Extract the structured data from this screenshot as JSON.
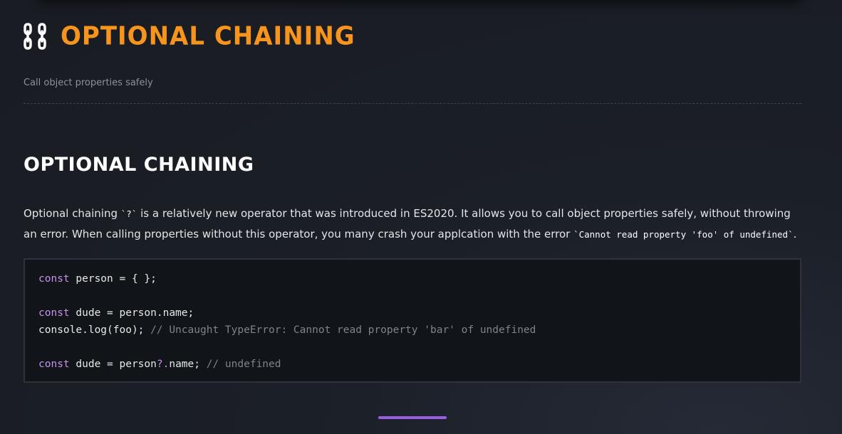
{
  "header": {
    "icon": "chain-icon",
    "title": "Optional Chaining",
    "subtitle": "Call object properties safely"
  },
  "section": {
    "heading": "Optional Chaining",
    "paragraph": {
      "part1": "Optional chaining ",
      "code1": "`?`",
      "part2": " is a relatively new operator that was introduced in ES2020. It allows you to call object properties safely, without throwing an error. When calling properties without this operator, you many crash your applcation with the error ",
      "code2": "`Cannot read property 'foo' of undefined`",
      "part3": "."
    }
  },
  "code": {
    "line1": {
      "kw": "const",
      "rest": " person = { };"
    },
    "line2": {
      "kw": "const",
      "rest": " dude = person.name;"
    },
    "line3": {
      "code": "console.log(foo); ",
      "comment": "// Uncaught TypeError: Cannot read property 'bar' of undefined"
    },
    "line4": {
      "kw": "const",
      "rest_a": " dude = person",
      "op": "?.",
      "rest_b": "name; ",
      "comment": "// undefined"
    }
  },
  "colors": {
    "accent": "#f7941d",
    "keyword": "#c792ea",
    "comment": "#7d848e",
    "pager": "#9b5de5"
  }
}
